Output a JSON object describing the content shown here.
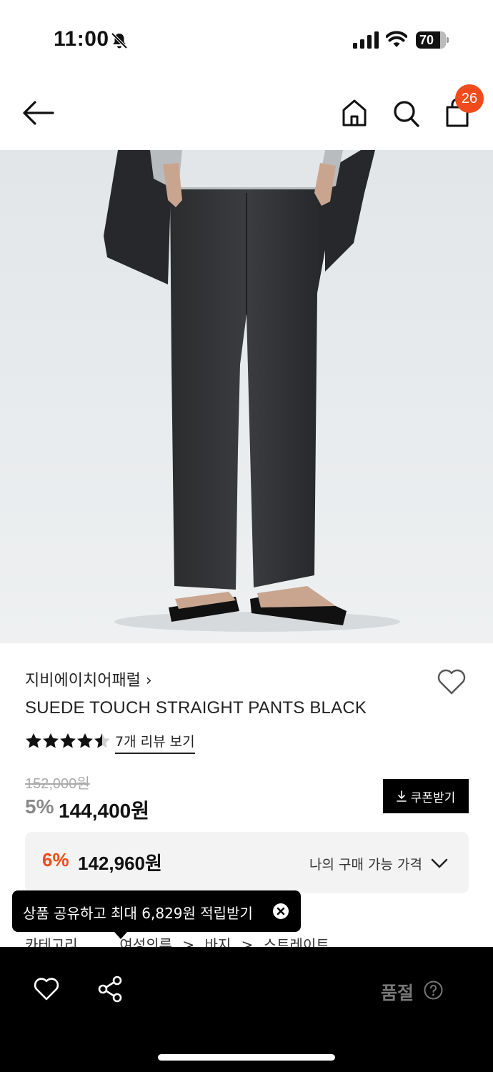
{
  "status_bar": {
    "time": "11:00",
    "battery": "70"
  },
  "header": {
    "cart_count": "26"
  },
  "product": {
    "brand": "지비에이치어패럴",
    "brand_chevron": "›",
    "title": "SUEDE TOUCH STRAIGHT PANTS BLACK",
    "rating": 4.5,
    "review_link": "7개 리뷰 보기",
    "original_price": "152,000원",
    "discount_rate": "5%",
    "sale_price": "144,400원",
    "coupon_button": "쿠폰받기"
  },
  "my_price": {
    "rate": "6%",
    "price": "142,960원",
    "label": "나의 구매 가능 가격"
  },
  "toast": {
    "text": "상품 공유하고 최대 6,829원 적립받기"
  },
  "category": {
    "label": "카테고리",
    "path": [
      "여성의류",
      "바지",
      "스트레이트"
    ],
    "separator": ">"
  },
  "bottom_bar": {
    "status": "품절"
  },
  "colors": {
    "accent": "#f04b1c",
    "dark": "#000000",
    "muted": "#777777"
  },
  "icons": [
    "back-arrow-icon",
    "home-icon",
    "search-icon",
    "bag-icon",
    "heart-icon",
    "share-icon",
    "download-icon",
    "chevron-down-icon",
    "close-icon",
    "help-icon",
    "bell-off-icon"
  ]
}
